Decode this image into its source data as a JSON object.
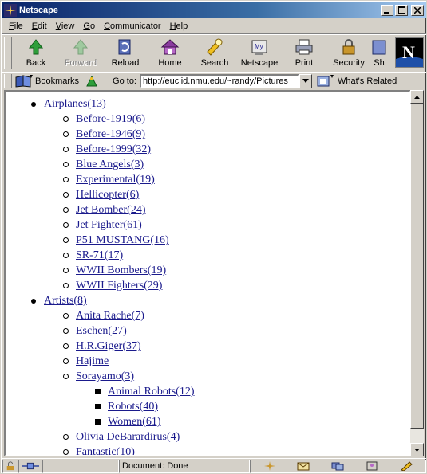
{
  "window": {
    "title": "Netscape"
  },
  "menu": [
    "File",
    "Edit",
    "View",
    "Go",
    "Communicator",
    "Help"
  ],
  "toolbar": [
    {
      "label": "Back",
      "icon": "back-arrow-icon",
      "disabled": false
    },
    {
      "label": "Forward",
      "icon": "forward-arrow-icon",
      "disabled": true
    },
    {
      "label": "Reload",
      "icon": "reload-icon",
      "disabled": false
    },
    {
      "label": "Home",
      "icon": "home-icon",
      "disabled": false
    },
    {
      "label": "Search",
      "icon": "search-icon",
      "disabled": false
    },
    {
      "label": "Netscape",
      "icon": "my-netscape-icon",
      "disabled": false
    },
    {
      "label": "Print",
      "icon": "printer-icon",
      "disabled": false
    },
    {
      "label": "Security",
      "icon": "padlock-icon",
      "disabled": false
    },
    {
      "label": "Sh",
      "icon": "shop-icon",
      "disabled": false
    }
  ],
  "location": {
    "bookmarks_label": "Bookmarks",
    "goto_label": "Go to:",
    "url": "http://euclid.nmu.edu/~randy/Pictures",
    "related_label": "What's Related"
  },
  "status": {
    "text": "Document: Done"
  },
  "tree": [
    {
      "label": "Airplanes(13)",
      "children": [
        {
          "label": "Before-1919(6)"
        },
        {
          "label": "Before-1946(9)"
        },
        {
          "label": "Before-1999(32)"
        },
        {
          "label": "Blue Angels(3)"
        },
        {
          "label": "Experimental(19)"
        },
        {
          "label": "Hellicopter(6)"
        },
        {
          "label": "Jet Bomber(24)"
        },
        {
          "label": "Jet Fighter(61)"
        },
        {
          "label": "P51 MUSTANG(16)"
        },
        {
          "label": "SR-71(17)"
        },
        {
          "label": "WWII Bombers(19)"
        },
        {
          "label": "WWII Fighters(29)"
        }
      ]
    },
    {
      "label": "Artists(8)",
      "children": [
        {
          "label": "Anita Rache(7)"
        },
        {
          "label": "Eschen(27)"
        },
        {
          "label": "H.R.Giger(37)"
        },
        {
          "label": "Hajime"
        },
        {
          "label": "Sorayamo(3)",
          "children": [
            {
              "label": "Animal Robots(12)"
            },
            {
              "label": "Robots(40)"
            },
            {
              "label": "Women(61)"
            }
          ]
        },
        {
          "label": "Olivia DeBarardirus(4)"
        },
        {
          "label": "Fantastic(10)"
        }
      ]
    }
  ]
}
